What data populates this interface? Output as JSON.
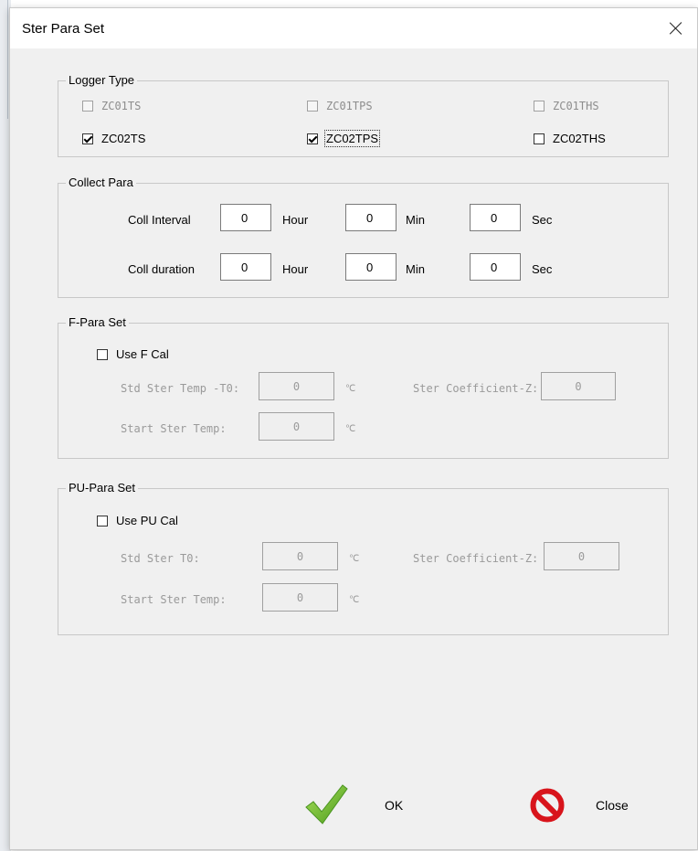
{
  "window": {
    "title": "Ster Para Set"
  },
  "logger_type": {
    "title": "Logger Type",
    "options": [
      {
        "label": "ZC01TS",
        "checked": false,
        "enabled": false
      },
      {
        "label": "ZC01TPS",
        "checked": false,
        "enabled": false
      },
      {
        "label": "ZC01THS",
        "checked": false,
        "enabled": false
      },
      {
        "label": "ZC02TS",
        "checked": true,
        "enabled": true
      },
      {
        "label": "ZC02TPS",
        "checked": true,
        "enabled": true
      },
      {
        "label": "ZC02THS",
        "checked": false,
        "enabled": true
      }
    ]
  },
  "collect_para": {
    "title": "Collect Para",
    "interval": {
      "label": "Coll Interval",
      "hour": "0",
      "min": "0",
      "sec": "0"
    },
    "duration": {
      "label": "Coll duration",
      "hour": "0",
      "min": "0",
      "sec": "0"
    },
    "units": {
      "hour": "Hour",
      "min": "Min",
      "sec": "Sec"
    }
  },
  "f_para": {
    "title": "F-Para Set",
    "use_label": "Use F Cal",
    "std_label": "Std Ster Temp -T0:",
    "std_value": "0",
    "start_label": "Start Ster Temp:",
    "start_value": "0",
    "coef_label": "Ster Coefficient-Z:",
    "coef_value": "0",
    "unit": "℃"
  },
  "pu_para": {
    "title": "PU-Para Set",
    "use_label": "Use PU Cal",
    "std_label": "Std Ster T0:",
    "std_value": "0",
    "start_label": "Start Ster Temp:",
    "start_value": "0",
    "coef_label": "Ster Coefficient-Z:",
    "coef_value": "0",
    "unit": "℃"
  },
  "buttons": {
    "ok": "OK",
    "close": "Close"
  },
  "icons": {
    "ok": "checkmark-icon",
    "close": "no-entry-icon",
    "window_close": "close-icon"
  },
  "colors": {
    "ok_green": "#6fbf2a",
    "close_red": "#d8141b"
  }
}
